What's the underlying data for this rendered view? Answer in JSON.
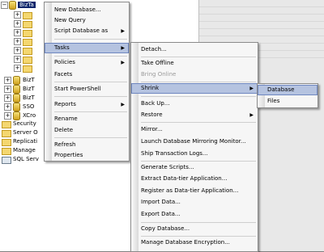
{
  "tree": {
    "server_db_label": "BizTa",
    "items": [
      {
        "label": "BizT",
        "kind": "db"
      },
      {
        "label": "BizT",
        "kind": "db"
      },
      {
        "label": "BizT",
        "kind": "db"
      },
      {
        "label": "SSO",
        "kind": "db"
      },
      {
        "label": "XCro",
        "kind": "db"
      },
      {
        "label": "Security",
        "kind": "folder"
      },
      {
        "label": "Server O",
        "kind": "folder"
      },
      {
        "label": "Replicati",
        "kind": "folder"
      },
      {
        "label": "Manage",
        "kind": "folder"
      },
      {
        "label": "SQL Serv",
        "kind": "agent"
      }
    ]
  },
  "context_menu": {
    "new_database": "New Database...",
    "new_query": "New Query",
    "script_database_as": "Script Database as",
    "tasks": "Tasks",
    "policies": "Policies",
    "facets": "Facets",
    "start_powershell": "Start PowerShell",
    "reports": "Reports",
    "rename": "Rename",
    "delete": "Delete",
    "refresh": "Refresh",
    "properties": "Properties"
  },
  "tasks_menu": {
    "detach": "Detach...",
    "take_offline": "Take Offline",
    "bring_online": "Bring Online",
    "shrink": "Shrink",
    "back_up": "Back Up...",
    "restore": "Restore",
    "mirror": "Mirror...",
    "launch_mirroring_monitor": "Launch Database Mirroring Monitor...",
    "ship_transaction_logs": "Ship Transaction Logs...",
    "generate_scripts": "Generate Scripts...",
    "extract_data_tier": "Extract Data-tier Application...",
    "register_data_tier": "Register as Data-tier Application...",
    "import_data": "Import Data...",
    "export_data": "Export Data...",
    "copy_database": "Copy Database...",
    "manage_encryption": "Manage Database Encryption..."
  },
  "shrink_menu": {
    "database": "Database",
    "files": "Files"
  },
  "arrow_glyph": "▶",
  "colors": {
    "highlight": "#b5c3e0",
    "selection": "#0a246a",
    "background": "#808080"
  }
}
